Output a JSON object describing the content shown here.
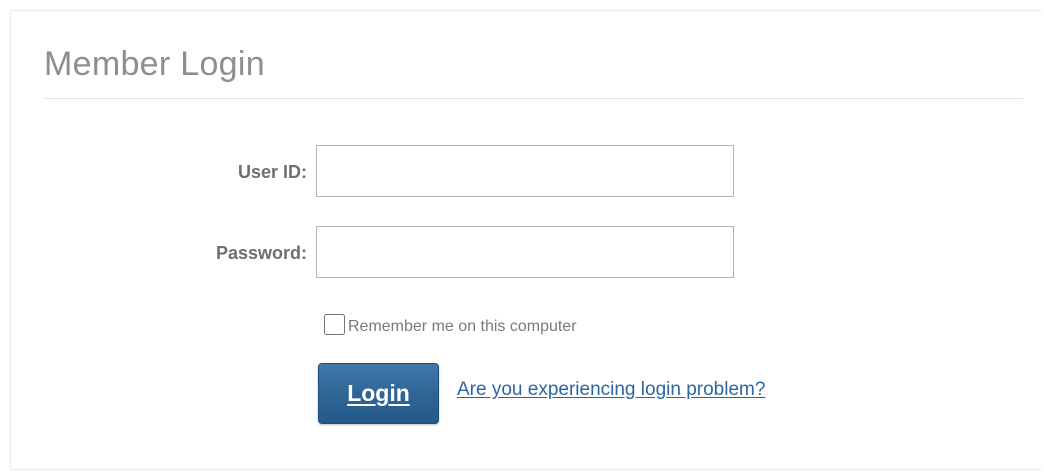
{
  "page": {
    "title": "Member Login"
  },
  "form": {
    "user_id": {
      "label": "User ID:",
      "value": "",
      "placeholder": ""
    },
    "password": {
      "label": "Password:",
      "value": "",
      "placeholder": ""
    },
    "remember_me": {
      "label": "Remember me on this computer",
      "checked": false
    },
    "login_button_label": "Login",
    "help_link_text": "Are you experiencing login problem?"
  },
  "colors": {
    "accent": "#2f6696",
    "link": "#2a67a0",
    "title": "#8e8e8e",
    "label": "#6f6f6f"
  }
}
